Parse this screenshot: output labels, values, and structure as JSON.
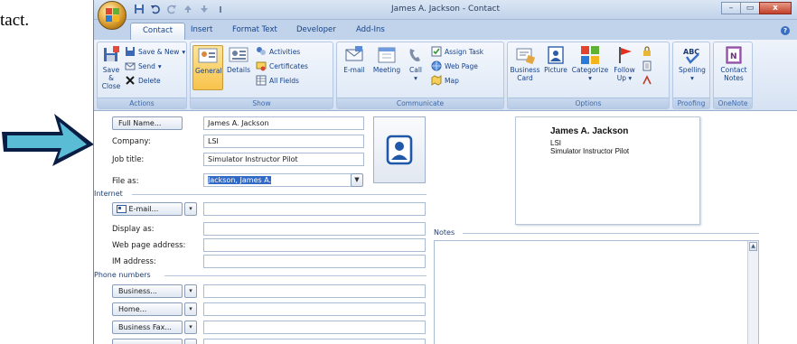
{
  "document": {
    "fragment_text": "tact."
  },
  "window": {
    "title": "James A. Jackson - Contact",
    "buttons": {
      "minimize": "–",
      "maximize": "▭",
      "close": "x"
    }
  },
  "tabs": [
    "Contact",
    "Insert",
    "Format Text",
    "Developer",
    "Add-Ins"
  ],
  "help_glyph": "?",
  "ribbon": {
    "actions": {
      "label": "Actions",
      "save_close": "Save &",
      "save_close2": "Close",
      "save_new": "Save & New",
      "send": "Send",
      "delete": "Delete"
    },
    "show": {
      "label": "Show",
      "general": "General",
      "details": "Details",
      "activities": "Activities",
      "certificates": "Certificates",
      "all_fields": "All Fields"
    },
    "communicate": {
      "label": "Communicate",
      "email": "E-mail",
      "meeting": "Meeting",
      "call": "Call",
      "assign_task": "Assign Task",
      "web_page": "Web Page",
      "map": "Map"
    },
    "options": {
      "label": "Options",
      "business_card": "Business",
      "business_card2": "Card",
      "picture": "Picture",
      "categorize": "Categorize",
      "follow_up": "Follow",
      "follow_up2": "Up"
    },
    "proofing": {
      "label": "Proofing",
      "spelling": "Spelling"
    },
    "onenote": {
      "label": "OneNote",
      "contact_notes": "Contact",
      "contact_notes2": "Notes"
    }
  },
  "form": {
    "full_name_button": "Full Name...",
    "full_name_value": "James A. Jackson",
    "company_label": "Company:",
    "company_value": "LSI",
    "job_title_label": "Job title:",
    "job_title_value": "Simulator Instructor Pilot",
    "file_as_label": "File as:",
    "file_as_value": "Jackson, James A.",
    "internet_section": "Internet",
    "email_button": "E-mail...",
    "display_as_label": "Display as:",
    "web_page_label": "Web page address:",
    "im_label": "IM address:",
    "phone_section": "Phone numbers",
    "business_button": "Business...",
    "home_button": "Home...",
    "business_fax_button": "Business Fax...",
    "notes_section": "Notes"
  },
  "business_card": {
    "name": "James A. Jackson",
    "company": "LSI",
    "title": "Simulator Instructor Pilot"
  },
  "colors": {
    "ribbon_text": "#15428b",
    "arrow_fill": "#5bbcd6",
    "arrow_outline": "#0a1d44",
    "selection": "#3169c6"
  }
}
